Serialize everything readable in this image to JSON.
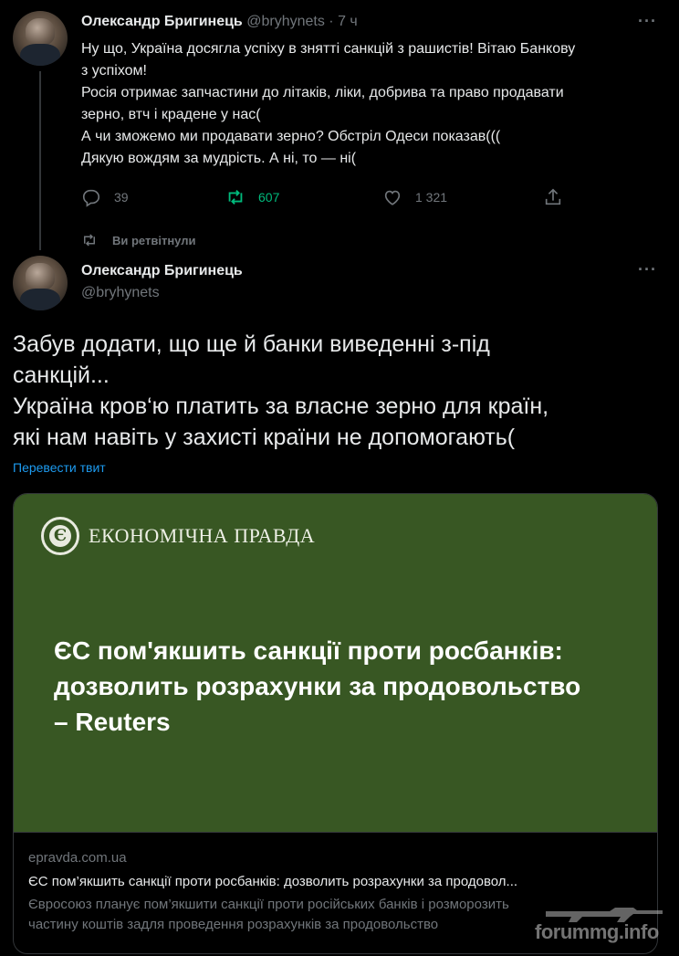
{
  "tweet1": {
    "author_name": "Олександр Бригинець",
    "handle": "@bryhynets",
    "separator": "·",
    "time": "7 ч",
    "lines": [
      "Ну що, Україна досягла успіху в знятті санкцій з рашистів! Вітаю Банкову",
      "з успіхом!",
      "Росія отримає запчастини до літаків, ліки, добрива та право продавати",
      "зерно, втч і крадене у нас(",
      "А чи зможемо ми продавати зерно? Обстріл Одеси показав(((",
      "Дякую вождям за мудрість. А ні, то — ні("
    ],
    "reply_count": "39",
    "retweet_count": "607",
    "like_count": "1 321",
    "retweet_color": "#00ba7c"
  },
  "retweeted_label": "Ви ретвітнули",
  "tweet2": {
    "author_name": "Олександр Бригинець",
    "handle": "@bryhynets",
    "lines": [
      "Забув додати, що ще й банки виведенні з-під",
      "санкцій...",
      "Україна кров‘ю платить за власне зерно для країн,",
      "які нам навіть у захисті країни не допомогають("
    ],
    "translate_link": "Перевести твит"
  },
  "card": {
    "logo_letter": "Є",
    "logo_text": "ЕКОНОМІЧНА ПРАВДА",
    "background_color": "#385723",
    "headline_lines": [
      "ЄС пом'якшить санкції проти росбанків:",
      "дозволить розрахунки за продовольство",
      "– Reuters"
    ],
    "domain": "epravda.com.ua",
    "title": "ЄС пом’якшить санкції проти росбанків: дозволить розрахунки за продовол...",
    "desc_lines": [
      "Євросоюз планує пом’якшити санкції проти російських банків і розморозить",
      "частину коштів задля проведення розрахунків за продовольство"
    ]
  },
  "watermark": "forummg.info",
  "icons": [
    "more-icon",
    "reply-icon",
    "retweet-icon",
    "like-icon",
    "share-icon",
    "retweeted-icon",
    "rifle-icon"
  ]
}
